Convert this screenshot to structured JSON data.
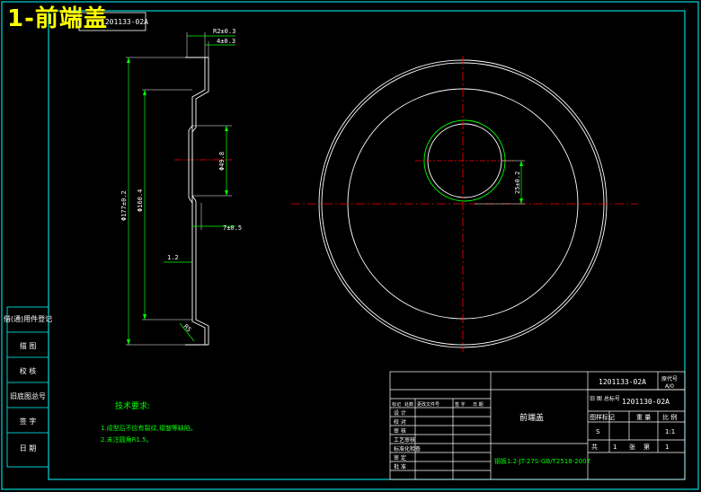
{
  "title": "1-前端盖",
  "top_tab": "1201133-02A",
  "dims": {
    "d1": "R2±0.3",
    "d2": "4±0.3",
    "d3": "Φ49.8",
    "d4": "7±0.5",
    "d5": "1.2",
    "d6": "Φ177±0.2",
    "d7": "Φ160.4",
    "d8": "R5",
    "d9": "25±0.2"
  },
  "tech": {
    "heading": "技术要求:",
    "items": [
      "1.成型后不应有裂纹,褶皱等缺陷。",
      "2.未注圆角R1.5。"
    ]
  },
  "left_table": [
    "借(通)用件登记",
    "描 图",
    "校 核",
    "旧底图总号",
    "签 字",
    "日 期"
  ],
  "title_block": {
    "drawing_no": "1201133-02A",
    "alt_no": "1201130-02A",
    "part_name": "前端盖",
    "material": "钢板1.2-JT-27S-GB/T2518-2007",
    "replace_label": "原代号",
    "replace_value": "A/0",
    "old_no_label": "旧 图 总标号",
    "mark_label": "图样标记",
    "weight_label": "重 量",
    "scale_label": "比 例",
    "mark_value": "S",
    "scale_value": "1:1",
    "sheets_total_label": "共",
    "sheets_total": "1",
    "sheet_label": "张",
    "sheet_no_label": "第",
    "sheet_no": "1",
    "rev_headers": [
      "标记",
      "处数",
      "更改文件号",
      "签 字",
      "日 期"
    ],
    "rows": [
      "设 计",
      "校 对",
      "审 核",
      "工艺审核",
      "标准化检查",
      "审 定",
      "批 准"
    ]
  }
}
